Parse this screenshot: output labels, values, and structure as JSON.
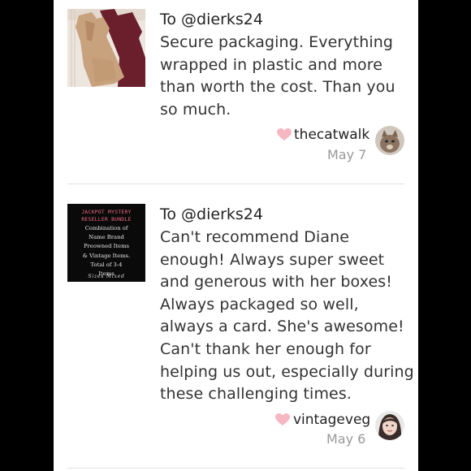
{
  "reviews": [
    {
      "to": "To @dierks24",
      "text": "Secure packaging. Everything wrapped in plastic and more than worth the cost. Than you so much.",
      "username": "thecatwalk",
      "date": "May 7",
      "thumbnail": "clothing-photo",
      "avatar": "cat-avatar"
    },
    {
      "to": "To @dierks24",
      "text": "Can't recommend Diane enough! Always super sweet and generous with her boxes! Always packaged so well, always a card. She's awesome! Can't thank her enough for helping us out, especially during these challenging times.",
      "username": "vintageveg",
      "date": "May 6",
      "thumbnail": "mystery-bundle-card",
      "bundle_card": {
        "title_line1": "JACKPOT MYSTERY",
        "title_line2": "RESELLER BUNDLE",
        "body_lines": [
          "Combination of",
          "Name Brand",
          "Preowned Items",
          "& Vintage Items.",
          "Total of 3-4",
          "Items"
        ],
        "footer": "Sizes Mixed"
      },
      "avatar": "woman-avatar"
    }
  ],
  "colors": {
    "heart": "#f7b7c2",
    "date": "#999999",
    "bundle_title": "#f06a7e"
  },
  "icons": [
    "heart-icon"
  ]
}
